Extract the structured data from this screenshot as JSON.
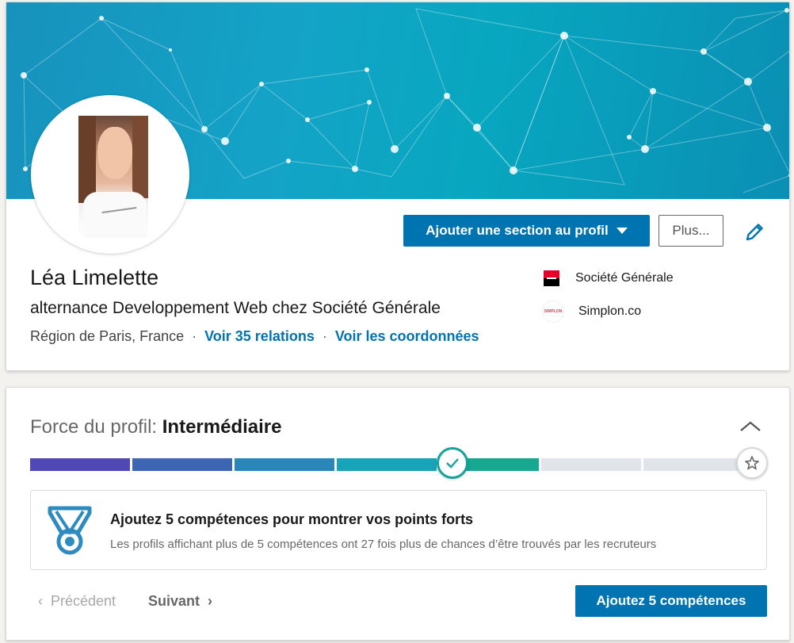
{
  "profile": {
    "name": "Léa Limelette",
    "headline": "alternance Developpement Web chez Société Générale",
    "location": "Région de Paris, France",
    "separator": "·",
    "relations_link": "Voir 35 relations",
    "contact_link": "Voir les coordonnées"
  },
  "actions": {
    "add_section_label": "Ajouter une section au profil",
    "more_label": "Plus..."
  },
  "companies": [
    {
      "name": "Société Générale",
      "logo": "societe-generale-logo"
    },
    {
      "name": "Simplon.co",
      "logo": "simplon-logo",
      "logo_text": "SIMPLON"
    }
  ],
  "strength": {
    "label": "Force du profil:",
    "level": "Intermédiaire",
    "progress_steps_completed": 5,
    "progress_steps_total": 7,
    "colors": [
      "#5048b4",
      "#3c66b4",
      "#2a86b8",
      "#17a3b8",
      "#17a892",
      "#e1e5e9",
      "#e1e5e9"
    ],
    "tip_title": "Ajoutez 5 compétences pour montrer vos points forts",
    "tip_desc": "Les profils affichant plus de 5 compétences ont 27 fois plus de chances d’être trouvés par les recruteurs",
    "prev_label": "Précédent",
    "next_label": "Suivant",
    "cta_label": "Ajoutez 5 compétences"
  }
}
